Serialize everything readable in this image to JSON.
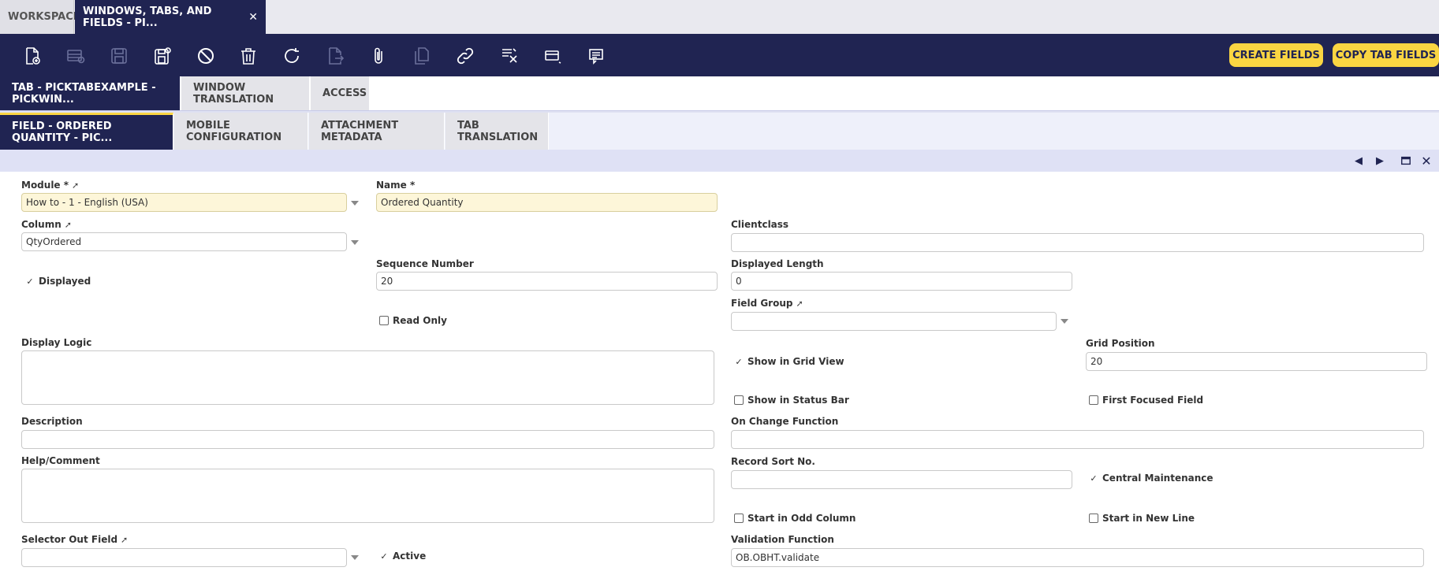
{
  "tabs": {
    "workspace": "WORKSPACE",
    "window": "WINDOWS, TABS, AND FIELDS - PI..."
  },
  "toolbar": {
    "create_fields": "CREATE FIELDS",
    "copy_tab_fields": "COPY TAB FIELDS",
    "icons": [
      "new-document-icon",
      "new-row-icon",
      "save-icon",
      "save-close-icon",
      "cancel-icon",
      "delete-icon",
      "refresh-icon",
      "export-icon",
      "attachment-icon",
      "clone-icon",
      "link-icon",
      "filter-icon",
      "grid-view-icon",
      "notes-icon"
    ]
  },
  "subtabs1": [
    "TAB - PICKTABEXAMPLE - PICKWIN...",
    "WINDOW TRANSLATION",
    "ACCESS"
  ],
  "subtabs2": [
    "FIELD - ORDERED QUANTITY - PIC...",
    "MOBILE CONFIGURATION",
    "ATTACHMENT METADATA",
    "TAB TRANSLATION"
  ],
  "form": {
    "module_label": "Module *",
    "module_value": "How to - 1 - English (USA)",
    "name_label": "Name *",
    "name_value": "Ordered Quantity",
    "column_label": "Column",
    "column_value": "QtyOrdered",
    "clientclass_label": "Clientclass",
    "clientclass_value": "",
    "displayed_label": "Displayed",
    "sequence_label": "Sequence Number",
    "sequence_value": "20",
    "displayed_length_label": "Displayed Length",
    "displayed_length_value": "0",
    "field_group_label": "Field Group",
    "read_only_label": "Read Only",
    "display_logic_label": "Display Logic",
    "show_grid_label": "Show in Grid View",
    "grid_position_label": "Grid Position",
    "grid_position_value": "20",
    "show_status_label": "Show in Status Bar",
    "first_focused_label": "First Focused Field",
    "description_label": "Description",
    "on_change_label": "On Change Function",
    "help_label": "Help/Comment",
    "record_sort_label": "Record Sort No.",
    "central_maint_label": "Central Maintenance",
    "odd_column_label": "Start in Odd Column",
    "new_line_label": "Start in New Line",
    "selector_out_label": "Selector Out Field",
    "active_label": "Active",
    "validation_label": "Validation Function",
    "validation_value": "OB.OBHT.validate"
  },
  "colors": {
    "navy": "#202452",
    "yellow": "#fad542",
    "required_bg": "#fdf6d9"
  }
}
